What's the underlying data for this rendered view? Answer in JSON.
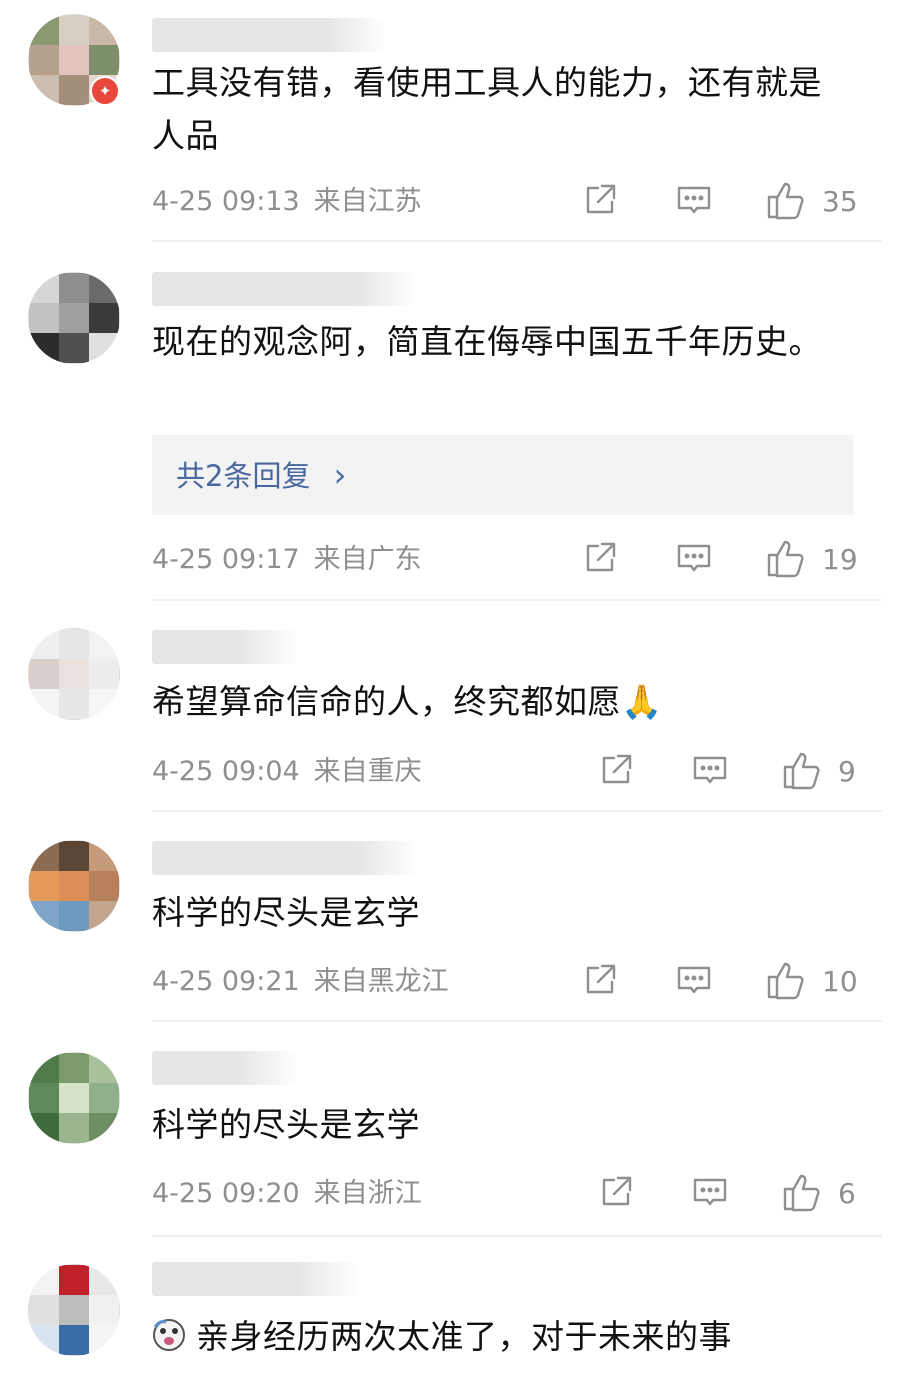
{
  "comments": [
    {
      "text": "工具没有错，看使用工具人的能力，还有就是人品",
      "time": "4-25 09:13",
      "location": "来自江苏",
      "likes": "35",
      "has_badge": true,
      "badge_symbol": "✦",
      "avatar_colors": [
        "#8a9a70",
        "#d8cfc4",
        "#c9b8a8",
        "#b5a18c",
        "#e4c4bf",
        "#7d8f6a",
        "#cdbdb0",
        "#a38e7b",
        "#e8d7cf"
      ]
    },
    {
      "text": "现在的观念阿，简直在侮辱中国五千年历史。",
      "replies": "共2条回复",
      "replies_arrow": "›",
      "time": "4-25 09:17",
      "location": "来自广东",
      "likes": "19",
      "avatar_colors": [
        "#d6d6d6",
        "#8e8e8e",
        "#6a6a6a",
        "#c2c2c2",
        "#a0a0a0",
        "#3a3a3a",
        "#2c2c2c",
        "#505050",
        "#e0e0e0"
      ]
    },
    {
      "text": "希望算命信命的人，终究都如愿",
      "emoji": "🙏",
      "time": "4-25 09:04",
      "location": "来自重庆",
      "likes": "9",
      "avatar_colors": [
        "#efefef",
        "#e6e6e6",
        "#f2f2f2",
        "#d8cfcc",
        "#e9e1de",
        "#ededed",
        "#f4f4f4",
        "#e7e7e7",
        "#f6f6f6"
      ]
    },
    {
      "text": "科学的尽头是玄学",
      "time": "4-25 09:21",
      "location": "来自黑龙江",
      "likes": "10",
      "avatar_colors": [
        "#8b6b52",
        "#5b4636",
        "#c49a7a",
        "#e39a5a",
        "#d98f55",
        "#b77f5a",
        "#7fa5c8",
        "#6f9abf",
        "#c2a58c"
      ]
    },
    {
      "text": "科学的尽头是玄学",
      "time": "4-25 09:20",
      "location": "来自浙江",
      "likes": "6",
      "avatar_colors": [
        "#4f7a4a",
        "#7c9a6a",
        "#a8c19a",
        "#5c8a5a",
        "#d6e3c8",
        "#8fb08a",
        "#3f6b3c",
        "#9bb58f",
        "#6e8f65"
      ]
    },
    {
      "text": "亲身经历两次太准了，对于未来的事",
      "time": "",
      "location": "",
      "likes": "",
      "leading_icon": "emoji-face-icon",
      "avatar_colors": [
        "#f2f2f2",
        "#c0202a",
        "#e8e8e8",
        "#e0e0e0",
        "#bdbdbd",
        "#f0f0f0",
        "#d8e4ef",
        "#3a6ea8",
        "#f5f5f5"
      ]
    }
  ],
  "icons": {
    "share": "share-icon",
    "comment": "comment-icon",
    "like": "like-icon"
  },
  "colors": {
    "meta_text": "#8f8f8f",
    "reply_link": "#4a68a0",
    "badge": "#e8483b"
  }
}
